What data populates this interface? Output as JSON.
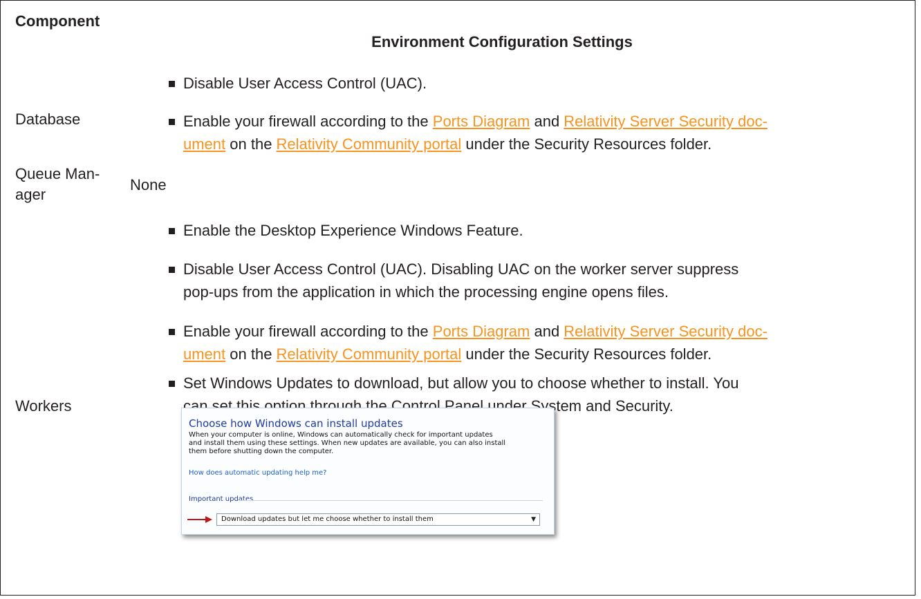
{
  "header": {
    "component": "Component",
    "settings": "Environment Configuration Settings"
  },
  "rows": {
    "database": {
      "label": "Database",
      "bullets": [
        {
          "text": "Disable User Access Control (UAC)."
        },
        {
          "p1": "Enable your firewall according to the ",
          "link1": "Ports Diagram",
          "p2": " and ",
          "link2a": "Relativity Server Security doc-",
          "link2b": "ument",
          "p3": " on the ",
          "link3": "Relativity Community portal",
          "p4": " under the Security Resources folder."
        }
      ]
    },
    "queue_manager": {
      "label_line1": "Queue Man-",
      "label_line2": "ager",
      "value": "None"
    },
    "workers": {
      "label": "Workers",
      "bullets": [
        {
          "text": "Enable the Desktop Experience Windows Feature."
        },
        {
          "line1": "Disable User Access Control (UAC). Disabling UAC on the worker server suppress",
          "line2": "pop-ups from the application in which the processing engine opens files."
        },
        {
          "p1": "Enable your firewall according to the ",
          "link1": "Ports Diagram",
          "p2": " and ",
          "link2a": "Relativity Server Security doc-",
          "link2b": "ument",
          "p3": " on the ",
          "link3": "Relativity Community portal",
          "p4": " under the Security Resources folder."
        },
        {
          "line1": "Set Windows Updates to download, but allow you to choose whether to install. You",
          "line2": "can set this option through the Control Panel under System and Security."
        }
      ]
    }
  },
  "dialog": {
    "title": "Choose how Windows can install updates",
    "body_line1": "When your computer is online, Windows can automatically check for important updates",
    "body_line2": "and install them using these settings. When new updates are available, you can also install",
    "body_line3": "them before shutting down the computer.",
    "help_link": "How does automatic updating help me?",
    "section": "Important updates",
    "selected_option": "Download updates but let me choose whether to install them"
  },
  "colors": {
    "link": "#f7931e",
    "text": "#231f20",
    "dialog_title": "#1e3b9c",
    "arrow": "#c0161a"
  }
}
